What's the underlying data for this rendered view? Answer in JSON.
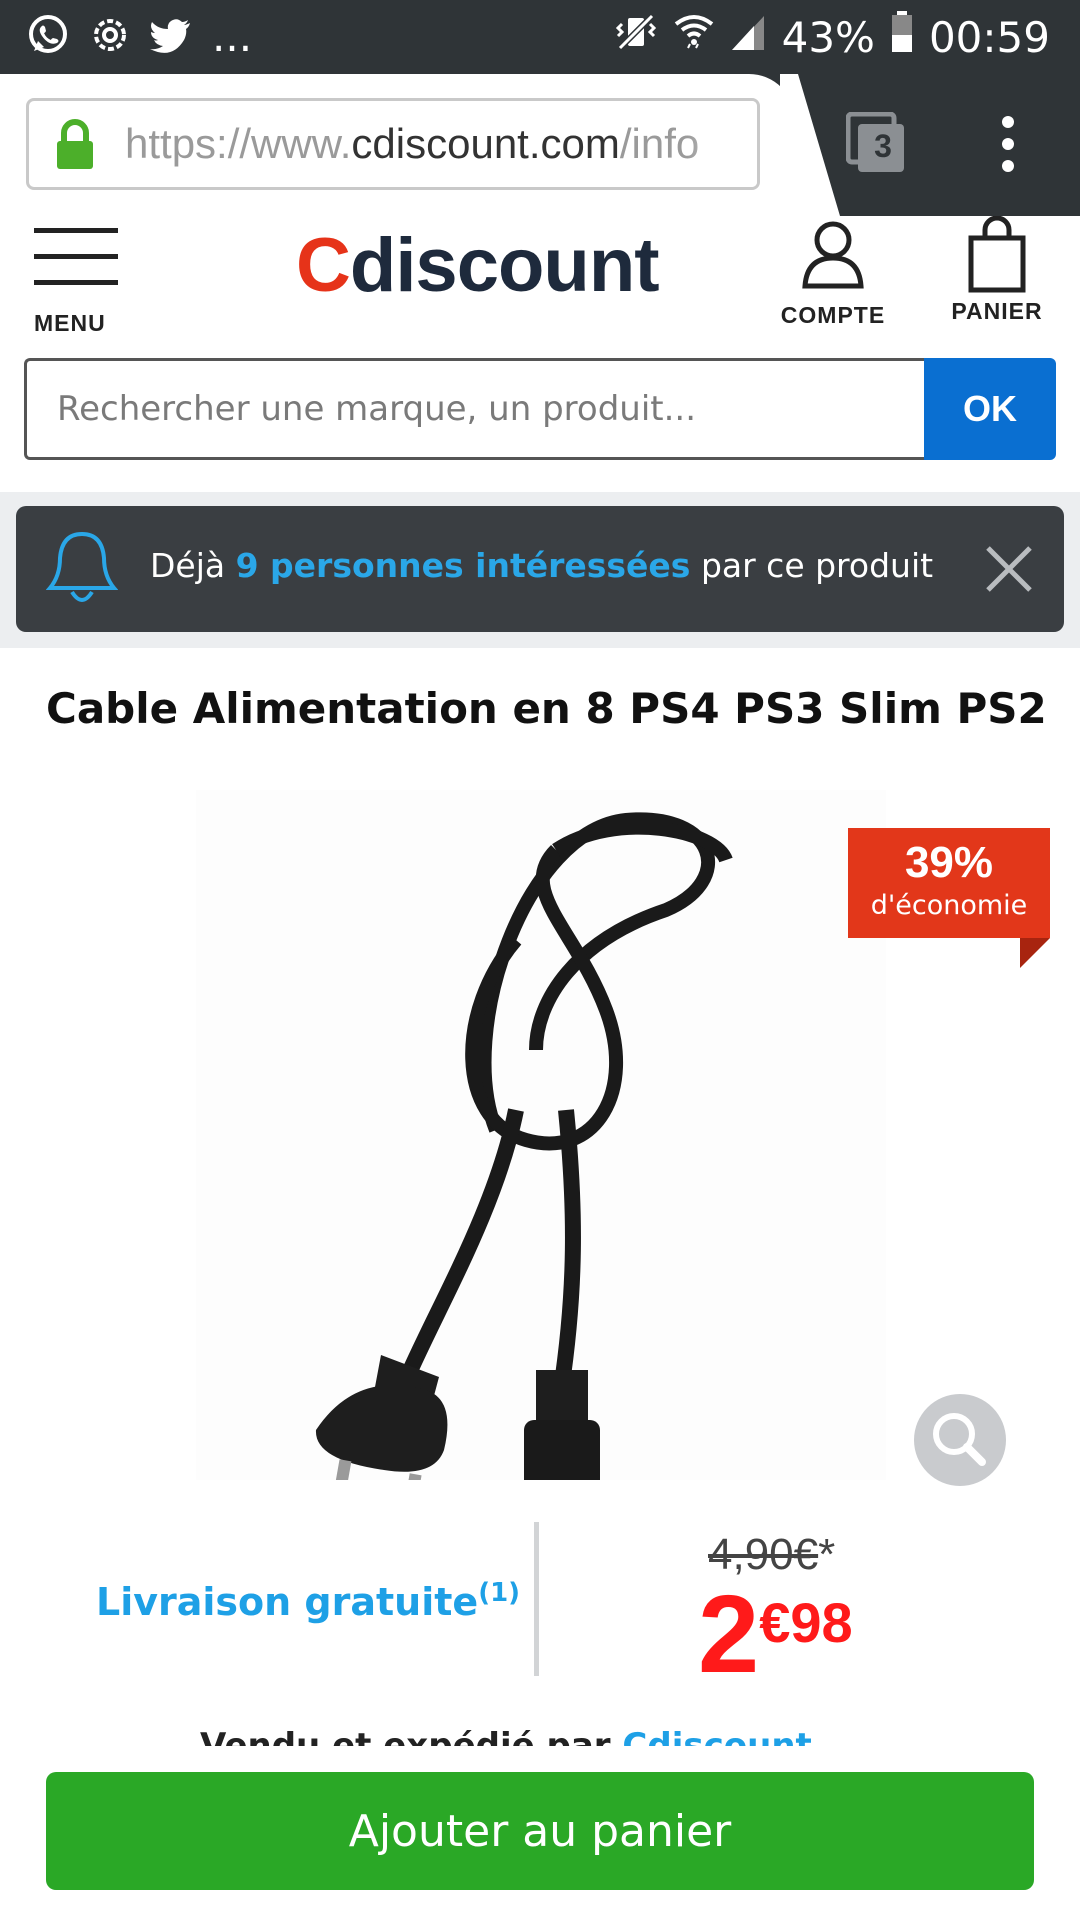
{
  "status_bar": {
    "notifications_more": "...",
    "battery": "43%",
    "time": "00:59",
    "icons": [
      "whatsapp-icon",
      "settings-icon",
      "twitter-icon",
      "vibrate-icon",
      "wifi-icon",
      "signal-icon",
      "battery-icon"
    ]
  },
  "browser": {
    "url_scheme": "https://www.",
    "url_host": "cdiscount.com",
    "url_path": "/info",
    "tab_count": "3"
  },
  "header": {
    "menu_label": "MENU",
    "logo_first": "C",
    "logo_rest": "discount",
    "account_label": "COMPTE",
    "cart_label": "PANIER"
  },
  "search": {
    "placeholder": "Rechercher une marque, un produit...",
    "button_label": "OK"
  },
  "notification": {
    "prefix": "Déjà ",
    "highlight": "9 personnes intéressées",
    "suffix": " par ce produit"
  },
  "product": {
    "title": "Cable Alimentation en 8 PS4 PS3 Slim PS2",
    "discount_percent": "39%",
    "discount_label": "d'économie",
    "delivery": "Livraison gratuite",
    "delivery_note": "(1)",
    "old_price": "4,90€",
    "old_price_mark": "*",
    "price_integer": "2",
    "price_decimal": "€98",
    "seller_prefix": "Vendu et expédié par ",
    "seller_name": "Cdiscount"
  },
  "actions": {
    "add_to_cart": "Ajouter au panier"
  },
  "colors": {
    "brand_red": "#e63319",
    "brand_navy": "#1e2a3c",
    "ok_blue": "#0a6fd1",
    "price_red": "#ff1a1a",
    "link_blue": "#1ea0e6",
    "cart_green": "#2aa826"
  }
}
